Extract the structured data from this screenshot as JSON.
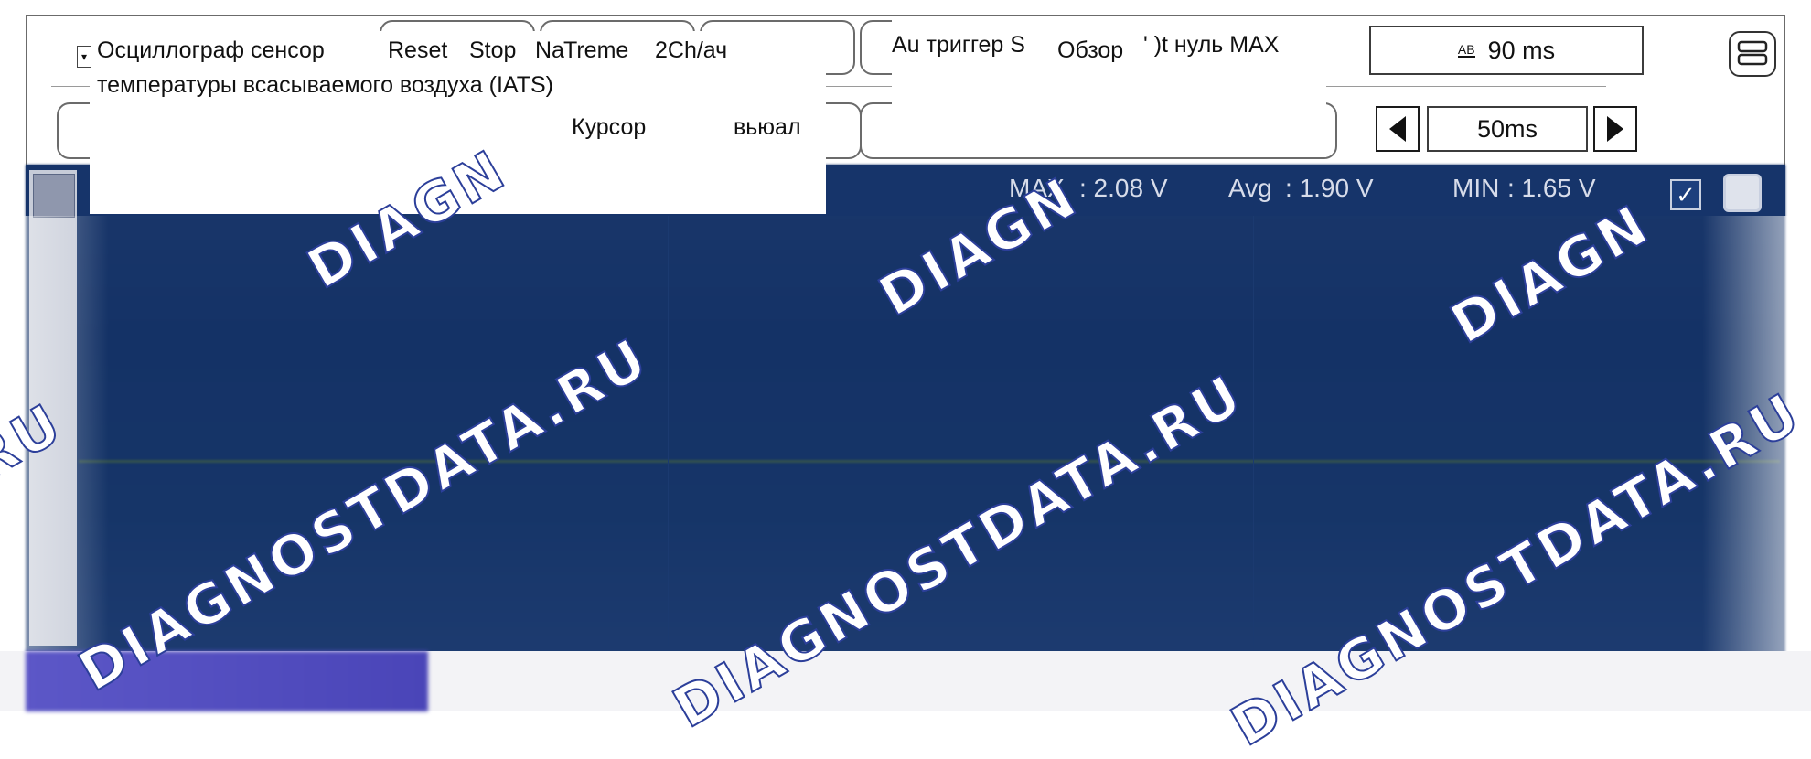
{
  "window": {
    "title_line1": "Осциллограф сенсор",
    "title_line2": "температуры всасываемого воздуха (IATS)"
  },
  "toolbar": {
    "reset_label": "Reset",
    "stop_label": "Stop",
    "na_label": "Na",
    "treme_label": "Treme",
    "channel_label": "2Ch/ач",
    "auto_trigger_label": "Au триггер S",
    "overview_label": "Обзор",
    "overview_tail": "' )t нуль MAX",
    "cursor_label": "Курсор",
    "view_label": "вьюал",
    "ab_icon_label": "AB",
    "ab_value": "90 ms",
    "time_div_value": "50ms"
  },
  "stats": {
    "max_label": "MAX",
    "max_value": ": 2.08 V",
    "avg_label": "Avg",
    "avg_value": ": 1.90 V",
    "min_label": "MIN",
    "min_value": ": 1.65 V"
  },
  "watermark": {
    "text_short": "DIAGN",
    "text_full": "DIAGNOSTDATA.RU",
    "text_ru": "RU"
  },
  "icons": [
    "menu-icon",
    "left-arrow-icon",
    "right-arrow-icon",
    "checkbox-icon",
    "ab-icon"
  ],
  "colors": {
    "scope_bg": "#163568",
    "stat_text": "#d7dcea"
  }
}
